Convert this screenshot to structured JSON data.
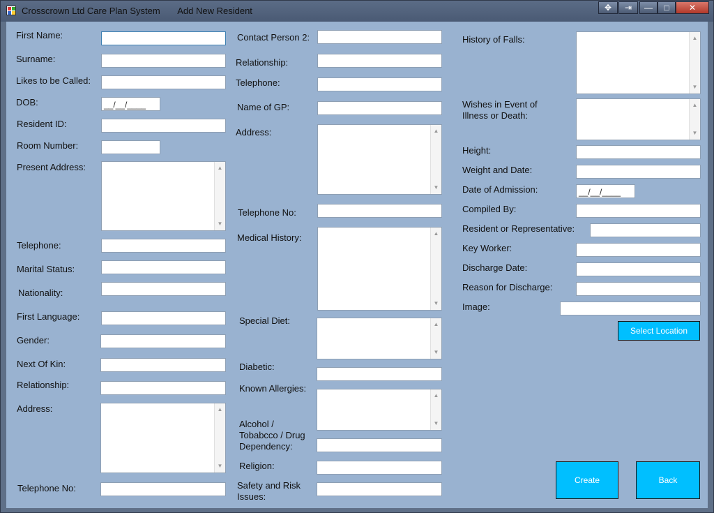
{
  "window": {
    "title": "Crosscrown Ltd Care Plan System       Add New Resident",
    "controls": {
      "move": "✥",
      "pin": "⇥",
      "minimize": "—",
      "maximize": "□",
      "close": "✕"
    }
  },
  "col1": {
    "first_name": "First Name:",
    "surname": "Surname:",
    "likes_to_be_called": "Likes to be Called:",
    "dob": "DOB:",
    "dob_mask": "__/__/____",
    "resident_id": "Resident ID:",
    "room_number": "Room Number:",
    "present_address": "Present Address:",
    "telephone": "Telephone:",
    "marital_status": "Marital Status:",
    "nationality": "Nationality:",
    "first_language": "First Language:",
    "gender": "Gender:",
    "next_of_kin": "Next Of Kin:",
    "relationship": "Relationship:",
    "address": "Address:",
    "telephone_no": "Telephone No:"
  },
  "col2": {
    "contact_person_2": "Contact Person 2:",
    "relationship": "Relationship:",
    "telephone": "Telephone:",
    "name_of_gp": "Name of GP:",
    "address": "Address:",
    "telephone_no": "Telephone No:",
    "medical_history": "Medical History:",
    "special_diet": "Special Diet:",
    "diabetic": "Diabetic:",
    "known_allergies": "Known Allergies:",
    "alcohol_line1": "Alcohol /",
    "alcohol_line2": "Tobabcco / Drug",
    "alcohol_line3": "Dependency:",
    "religion": "Religion:",
    "safety_line1": "Safety and Risk",
    "safety_line2": "Issues:"
  },
  "col3": {
    "history_of_falls": "History of Falls:",
    "wishes_line1": "Wishes in Event of",
    "wishes_line2": "Illness or Death:",
    "height": "Height:",
    "weight_and_date": "Weight and Date:",
    "date_of_admission": "Date of Admission:",
    "admission_mask": "__/__/____",
    "compiled_by": "Compiled By:",
    "resident_or_representative": "Resident or Representative:",
    "key_worker": "Key Worker:",
    "discharge_date": "Discharge Date:",
    "reason_for_discharge": "Reason for Discharge:",
    "image": "Image:"
  },
  "buttons": {
    "select_location": "Select Location",
    "create": "Create",
    "back": "Back"
  },
  "scroll": {
    "up": "▲",
    "down": "▼"
  }
}
